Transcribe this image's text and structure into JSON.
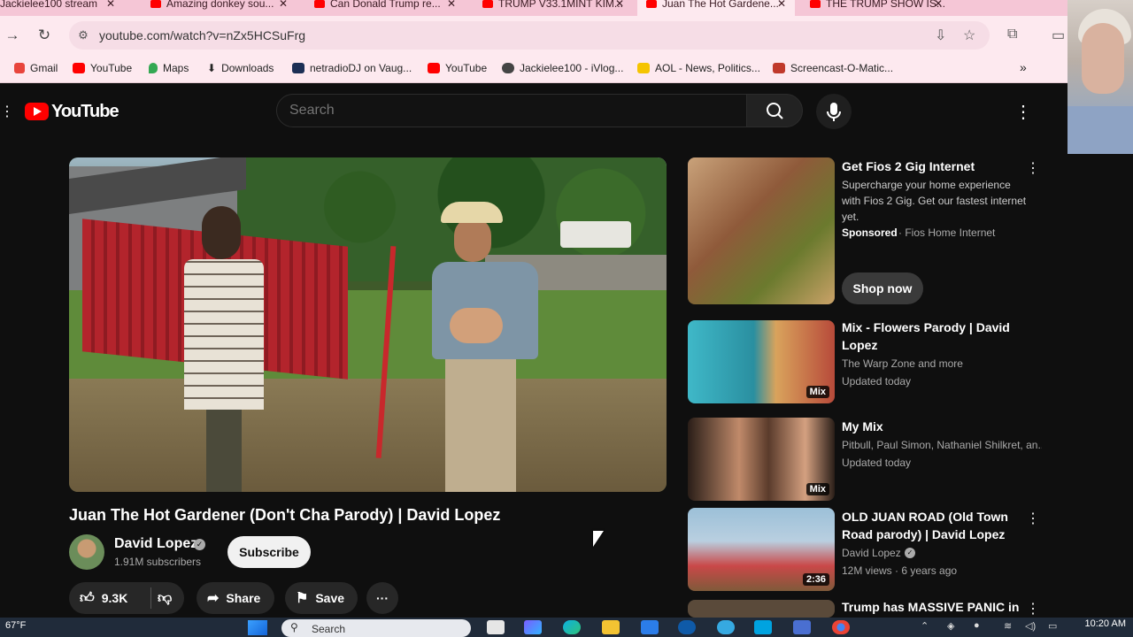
{
  "browser": {
    "tabs": [
      {
        "label": "Jackielee100 stream"
      },
      {
        "label": "Amazing donkey sou..."
      },
      {
        "label": "Can Donald Trump re..."
      },
      {
        "label": "TRUMP V33.1MINT KIM..."
      },
      {
        "label": "Juan The Hot Gardene..."
      },
      {
        "label": "THE TRUMP SHOW IS..."
      }
    ],
    "url": "youtube.com/watch?v=nZx5HCSuFrg",
    "bookmarks": [
      {
        "label": "Gmail"
      },
      {
        "label": "YouTube"
      },
      {
        "label": "Maps"
      },
      {
        "label": "Downloads"
      },
      {
        "label": "netradioDJ on Vaug..."
      },
      {
        "label": "YouTube"
      },
      {
        "label": "Jackielee100 - iVlog..."
      },
      {
        "label": "AOL - News, Politics..."
      },
      {
        "label": "Screencast-O-Matic..."
      }
    ],
    "bookmarks_overflow": "»"
  },
  "youtube": {
    "logo_text": "YouTube",
    "search_placeholder": "Search",
    "video": {
      "title": "Juan The Hot Gardener (Don't Cha Parody) | David Lopez",
      "channel": "David Lopez",
      "subscribers": "1.91M subscribers",
      "subscribe_label": "Subscribe",
      "likes": "9.3K",
      "share_label": "Share",
      "save_label": "Save"
    },
    "recommendations": [
      {
        "title": "Get Fios 2 Gig Internet",
        "description": "Supercharge your home experience with Fios 2 Gig. Get our fastest internet yet.",
        "sponsored": "Sponsored",
        "advertiser": "· Fios Home Internet",
        "cta": "Shop now"
      },
      {
        "title": "Mix - Flowers Parody | David Lopez",
        "line1": "The Warp Zone and more",
        "line2": "Updated today",
        "badge": "Mix"
      },
      {
        "title": "My Mix",
        "line1": "Pitbull, Paul Simon, Nathaniel Shilkret, an...",
        "line2": "Updated today",
        "badge": "Mix"
      },
      {
        "title": "OLD JUAN ROAD (Old Town Road parody) | David Lopez",
        "line1": "David Lopez",
        "line2": "12M views · 6 years ago",
        "badge": "2:36"
      },
      {
        "title": "Trump has MASSIVE PANIC in"
      }
    ]
  },
  "taskbar": {
    "weather": "67°F",
    "search_label": "Search",
    "time": "10:20 AM"
  }
}
